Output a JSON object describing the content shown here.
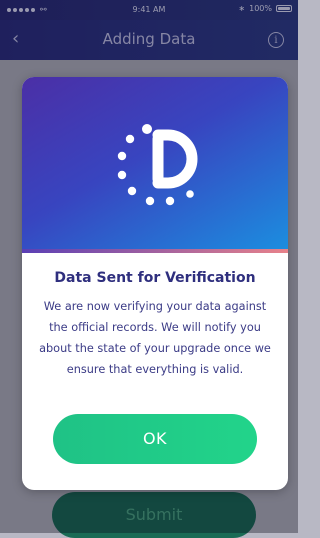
{
  "status_bar": {
    "time": "9:41 AM",
    "battery_percent": "100%",
    "wifi_icon": "wifi-icon",
    "bluetooth_icon": "bluetooth-icon"
  },
  "nav": {
    "title": "Adding Data",
    "back_icon": "chevron-left-icon",
    "info_icon": "info-icon"
  },
  "background": {
    "submit_label": "Submit"
  },
  "modal": {
    "title": "Data Sent for Verification",
    "message": "We are now verifying your data against the official records. We will notify you about the state of your upgrade once we ensure that everything is valid.",
    "ok_label": "OK",
    "logo_icon": "loading-d-logo-icon"
  },
  "colors": {
    "nav_bg": "#2b2d82",
    "hero_gradient_start": "#4b2fa6",
    "hero_gradient_end": "#1b8fe0",
    "title_text": "#2f2f7e",
    "ok_button": "#22d48a",
    "submit_button": "#1a6b55"
  }
}
